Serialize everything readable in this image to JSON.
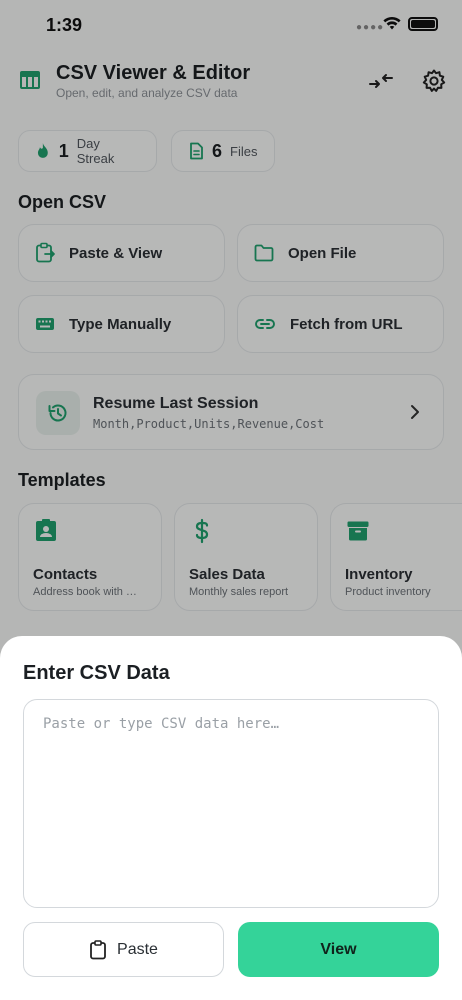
{
  "status_bar": {
    "time": "1:39"
  },
  "header": {
    "title": "CSV Viewer & Editor",
    "subtitle": "Open, edit, and analyze CSV data",
    "logo_icon": "table-icon",
    "compress_icon": "compress-arrows-icon",
    "settings_icon": "gear-icon"
  },
  "stats": {
    "streak": {
      "value": "1",
      "label": "Day Streak",
      "icon": "flame-icon"
    },
    "files": {
      "value": "6",
      "label": "Files",
      "icon": "document-icon"
    }
  },
  "open_csv": {
    "title": "Open CSV",
    "actions": [
      {
        "label": "Paste & View",
        "icon": "clipboard-paste-icon"
      },
      {
        "label": "Open File",
        "icon": "folder-icon"
      },
      {
        "label": "Type Manually",
        "icon": "keyboard-icon"
      },
      {
        "label": "Fetch from URL",
        "icon": "link-icon"
      }
    ]
  },
  "resume": {
    "title": "Resume Last Session",
    "subtitle": "Month,Product,Units,Revenue,Cost",
    "icon": "history-icon"
  },
  "templates": {
    "title": "Templates",
    "items": [
      {
        "title": "Contacts",
        "subtitle": "Address book with …",
        "icon": "contact-card-icon"
      },
      {
        "title": "Sales Data",
        "subtitle": "Monthly sales report",
        "icon": "dollar-icon"
      },
      {
        "title": "Inventory",
        "subtitle": "Product inventory",
        "icon": "archive-box-icon"
      }
    ]
  },
  "sheet": {
    "title": "Enter CSV Data",
    "input_placeholder": "Paste or type CSV data here…",
    "input_value": "",
    "paste_label": "Paste",
    "view_label": "View"
  },
  "colors": {
    "accent": "#34d399",
    "accent_dark": "#1f9e6d",
    "overlay": "rgba(0,0,0,0.26)"
  }
}
